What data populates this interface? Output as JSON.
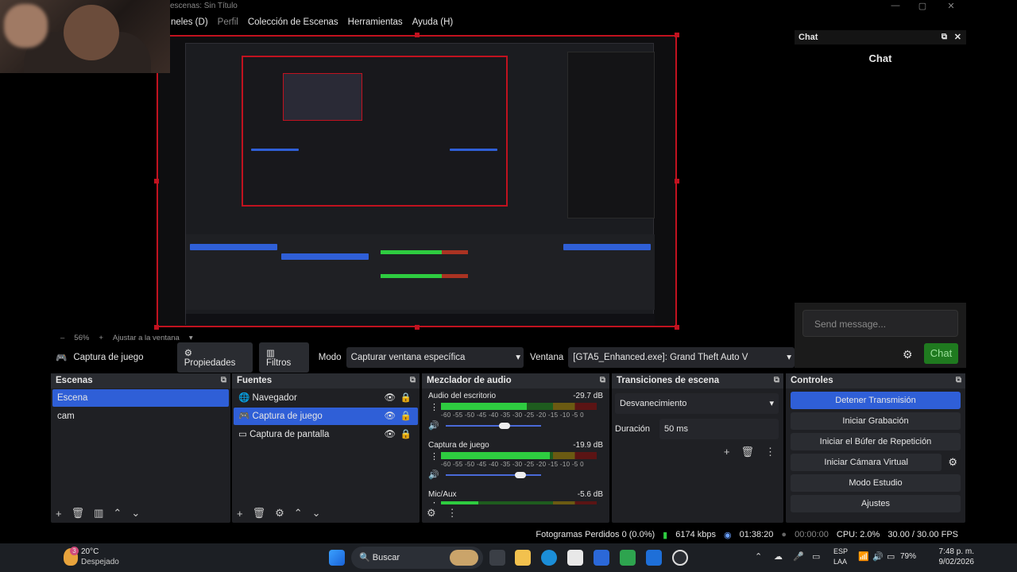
{
  "window": {
    "title": "escenas: Sin Título",
    "min": "—",
    "max": "▢",
    "close": "✕"
  },
  "menu": [
    "neles (D)",
    "Perfil",
    "Colección de Escenas",
    "Herramientas",
    "Ayuda (H)"
  ],
  "chat": {
    "dock_title": "Chat",
    "title": "Chat",
    "placeholder": "Send message...",
    "button": "Chat"
  },
  "zoom": {
    "minus": "–",
    "value": "56%",
    "plus": "+",
    "fit": "Ajustar a la ventana"
  },
  "sourcebar": {
    "source_name": "Captura de juego",
    "properties": "Propiedades",
    "filters": "Filtros",
    "mode_label": "Modo",
    "mode_value": "Capturar ventana específica",
    "window_label": "Ventana",
    "window_value": "[GTA5_Enhanced.exe]: Grand Theft Auto V"
  },
  "panels": {
    "scenes": {
      "title": "Escenas",
      "items": [
        "Escena",
        "cam"
      ],
      "selected": 0
    },
    "sources": {
      "title": "Fuentes",
      "items": [
        "Navegador",
        "Captura de juego",
        "Captura de pantalla"
      ],
      "selected": 1
    },
    "mixer": {
      "title": "Mezclador de audio",
      "channels": [
        {
          "name": "Audio del escritorio",
          "db": "-29.7 dB",
          "level": 0.55,
          "volume": 0.62
        },
        {
          "name": "Captura de juego",
          "db": "-19.9 dB",
          "level": 0.7,
          "volume": 0.78
        },
        {
          "name": "Mic/Aux",
          "db": "-5.6 dB",
          "level": 0.24,
          "volume": 0.5
        }
      ],
      "scale": "-60 -55 -50 -45 -40 -35 -30 -25 -20 -15 -10 -5 0"
    },
    "transitions": {
      "title": "Transiciones de escena",
      "value": "Desvanecimiento",
      "duration_label": "Duración",
      "duration_value": "50 ms"
    },
    "controls": {
      "title": "Controles",
      "buttons": [
        "Detener Transmisión",
        "Iniciar Grabación",
        "Iniciar el Búfer de Repetición",
        "Iniciar Cámara Virtual",
        "Modo Estudio",
        "Ajustes"
      ]
    }
  },
  "status": {
    "frames": "Fotogramas Perdidos 0 (0.0%)",
    "kbps": "6174 kbps",
    "stream_time": "01:38:20",
    "rec_time": "00:00:00",
    "cpu": "CPU: 2.0%",
    "fps": "30.00 / 30.00 FPS"
  },
  "taskbar": {
    "weather_temp": "20°C",
    "weather_desc": "Despejado",
    "weather_badge": "3",
    "search": "Buscar",
    "lang": "ESP",
    "region": "LAA",
    "battery": "79%",
    "time": "7:48 p. m.",
    "date": "9/02/2026"
  },
  "colors": {
    "accent": "#2f5fd7",
    "live_border": "#c1121f",
    "chat_button": "#1f7a1f"
  }
}
